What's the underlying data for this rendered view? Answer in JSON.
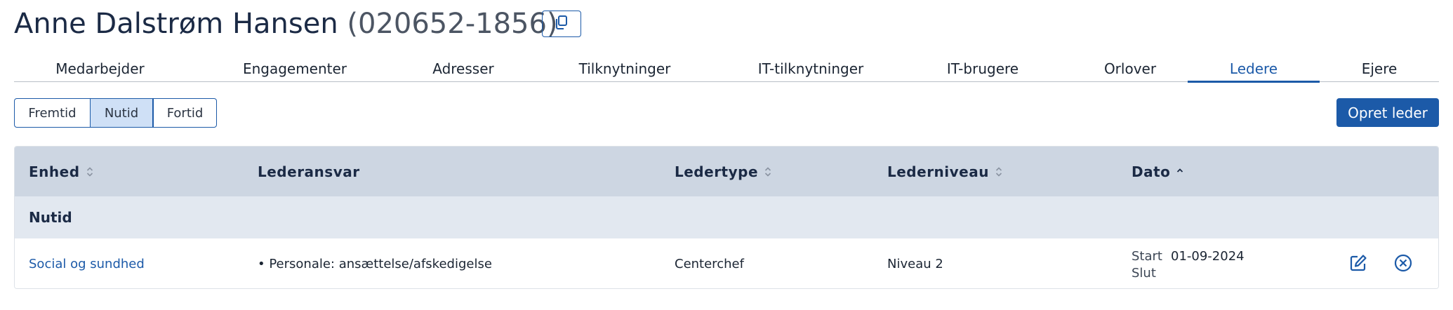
{
  "header": {
    "name": "Anne Dalstrøm Hansen",
    "cpr": "(020652-1856)",
    "copy_icon": "copy-icon"
  },
  "tabs": [
    {
      "label": "Medarbejder"
    },
    {
      "label": "Engagementer"
    },
    {
      "label": "Adresser"
    },
    {
      "label": "Tilknytninger"
    },
    {
      "label": "IT-tilknytninger"
    },
    {
      "label": "IT-brugere"
    },
    {
      "label": "Orlover"
    },
    {
      "label": "Ledere",
      "active": true
    },
    {
      "label": "Ejere"
    }
  ],
  "time_filter": {
    "options": [
      "Fremtid",
      "Nutid",
      "Fortid"
    ],
    "selected": "Nutid"
  },
  "create_button": "Opret leder",
  "table": {
    "columns": [
      {
        "label": "Enhed",
        "sort": "unsorted"
      },
      {
        "label": "Lederansvar",
        "sort": "none"
      },
      {
        "label": "Ledertype",
        "sort": "unsorted"
      },
      {
        "label": "Lederniveau",
        "sort": "unsorted"
      },
      {
        "label": "Dato",
        "sort": "ascending"
      }
    ],
    "group_label": "Nutid",
    "rows": [
      {
        "enhed": "Social og sundhed",
        "lederansvar": "• Personale: ansættelse/afskedigelse",
        "ledertype": "Centerchef",
        "lederniveau": "Niveau 2",
        "start_label": "Start",
        "start_value": "01-09-2024",
        "slut_label": "Slut",
        "slut_value": "",
        "actions": [
          "edit-icon",
          "remove-circle-icon"
        ]
      }
    ]
  },
  "colors": {
    "accent": "#1c5aa8",
    "table_header_bg": "#cdd6e2",
    "group_bg": "#e2e8f0",
    "selected_segment_bg": "#cfe0f6"
  }
}
